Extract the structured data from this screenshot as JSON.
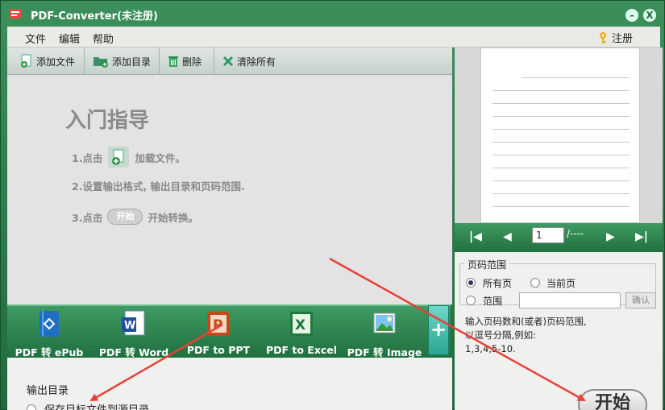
{
  "app": {
    "title": "PDF-Converter(未注册)"
  },
  "window_controls": {
    "minimize": "–",
    "close": "X"
  },
  "menu": {
    "items": [
      "文件",
      "编辑",
      "帮助"
    ],
    "register": "注册"
  },
  "toolbar": {
    "add_file": "添加文件",
    "add_dir": "添加目录",
    "delete": "删除",
    "clear_all": "清除所有"
  },
  "guide": {
    "title": "入门指导",
    "step1_prefix": "1.点击",
    "step1_suffix": "加载文件。",
    "step2": "2.设置输出格式, 输出目录和页码范围.",
    "step3_prefix": "3.点击",
    "step3_button": "开始",
    "step3_suffix": "开始转换。"
  },
  "converters": [
    "PDF 转 ePub",
    "PDF 转 Word",
    "PDF to PPT",
    "PDF to Excel",
    "PDF 转 Image"
  ],
  "add_format": "+",
  "output": {
    "label": "输出目录",
    "option_source": "保存目标文件到源目录"
  },
  "pager": {
    "current_page": "1",
    "total": "/----"
  },
  "page_range": {
    "title": "页码范围",
    "all_pages": "所有页",
    "current_page": "当前页",
    "range": "范围",
    "confirm": "确认",
    "hint_line1": "输入页码数和(或者)页码范围,",
    "hint_line2": "以逗号分隔,例如:",
    "hint_line3": "1,3,4,5-10."
  },
  "start_button": "开始",
  "colors": {
    "frame_green": "#2f7a4a",
    "arrow_red": "#e8403a"
  }
}
